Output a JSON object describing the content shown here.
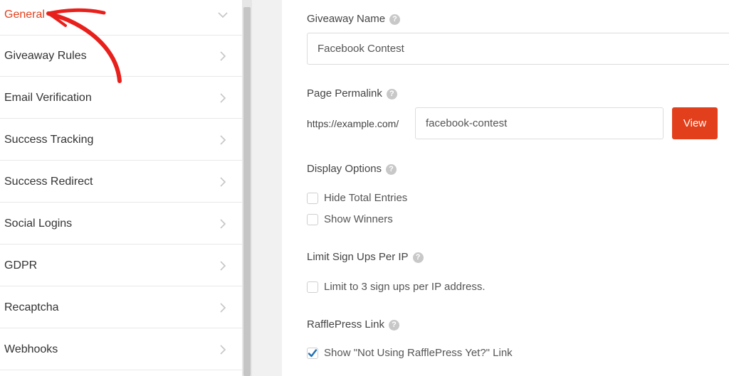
{
  "sidebar": {
    "items": [
      {
        "label": "General",
        "active": true
      },
      {
        "label": "Giveaway Rules"
      },
      {
        "label": "Email Verification"
      },
      {
        "label": "Success Tracking"
      },
      {
        "label": "Success Redirect"
      },
      {
        "label": "Social Logins"
      },
      {
        "label": "GDPR"
      },
      {
        "label": "Recaptcha"
      },
      {
        "label": "Webhooks"
      }
    ]
  },
  "main": {
    "giveaway_name": {
      "label": "Giveaway Name",
      "value": "Facebook Contest"
    },
    "permalink": {
      "label": "Page Permalink",
      "prefix": "https://example.com/",
      "value": "facebook-contest",
      "button": "View"
    },
    "display_options": {
      "label": "Display Options",
      "options": [
        {
          "label": "Hide Total Entries",
          "checked": false
        },
        {
          "label": "Show Winners",
          "checked": false
        }
      ]
    },
    "limit_signups": {
      "label": "Limit Sign Ups Per IP",
      "option": {
        "label": "Limit to 3 sign ups per IP address.",
        "checked": false
      }
    },
    "rafflepress_link": {
      "label": "RafflePress Link",
      "option": {
        "label": "Show \"Not Using RafflePress Yet?\" Link",
        "checked": true
      }
    },
    "help_glyph": "?"
  },
  "colors": {
    "accent": "#e2401c",
    "annotation": "#e8201c",
    "check": "#2271b1"
  }
}
